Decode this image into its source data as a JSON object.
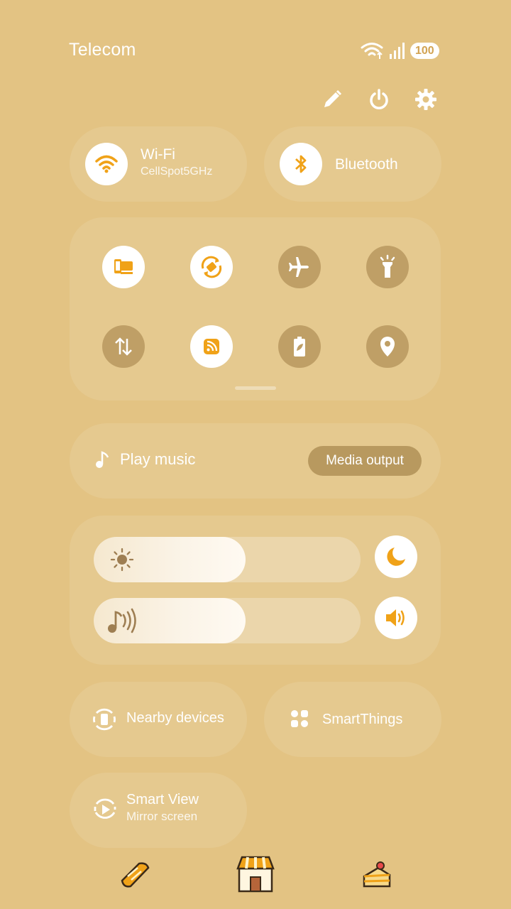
{
  "status_bar": {
    "carrier": "Telecom",
    "battery": "100"
  },
  "top_actions": {
    "edit_icon": "pencil-icon",
    "power_icon": "power-icon",
    "settings_icon": "gear-icon"
  },
  "wifi_tile": {
    "title": "Wi-Fi",
    "subtitle": "CellSpot5GHz"
  },
  "bluetooth_tile": {
    "title": "Bluetooth"
  },
  "quick_toggles": [
    {
      "name": "multi-control",
      "state": "on"
    },
    {
      "name": "auto-rotate",
      "state": "on"
    },
    {
      "name": "airplane-mode",
      "state": "off"
    },
    {
      "name": "flashlight",
      "state": "off"
    },
    {
      "name": "mobile-data",
      "state": "off"
    },
    {
      "name": "mobile-hotspot",
      "state": "on"
    },
    {
      "name": "power-saving",
      "state": "off"
    },
    {
      "name": "location",
      "state": "off"
    }
  ],
  "media": {
    "play_label": "Play music",
    "output_label": "Media output"
  },
  "sliders": {
    "brightness_level": 0.57,
    "volume_level": 0.57
  },
  "nearby_devices": {
    "label": "Nearby devices"
  },
  "smartthings": {
    "label": "SmartThings"
  },
  "smart_view": {
    "title": "Smart View",
    "subtitle": "Mirror screen"
  },
  "colors": {
    "background": "#e3c383",
    "accent": "#f0a218",
    "off_toggle": "#bf9f66"
  }
}
